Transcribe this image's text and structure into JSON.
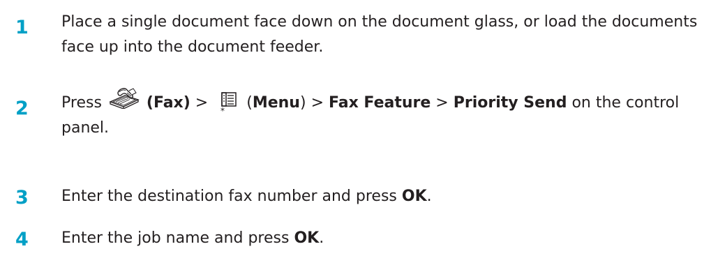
{
  "steps": [
    {
      "number": "1",
      "text": "Place a single document face down on the document glass, or load the documents face up into the document feeder."
    },
    {
      "number": "2",
      "press": "Press",
      "fax_label": "(Fax)",
      "sep1": ">",
      "menu_open": "(",
      "menu_label": "Menu",
      "menu_close": ")",
      "sep2": ">",
      "fax_feature": "Fax Feature",
      "sep3": ">",
      "priority_send": "Priority Send",
      "tail": "on the control panel.",
      "icons": [
        "fax-icon",
        "menu-icon"
      ]
    },
    {
      "number": "3",
      "text": "Enter the destination fax number and press",
      "ok": "OK",
      "end": "."
    },
    {
      "number": "4",
      "text": "Enter the job name and press",
      "ok": "OK",
      "end": "."
    }
  ],
  "colors": {
    "step_number": "#00a0c6",
    "text": "#231f20"
  }
}
